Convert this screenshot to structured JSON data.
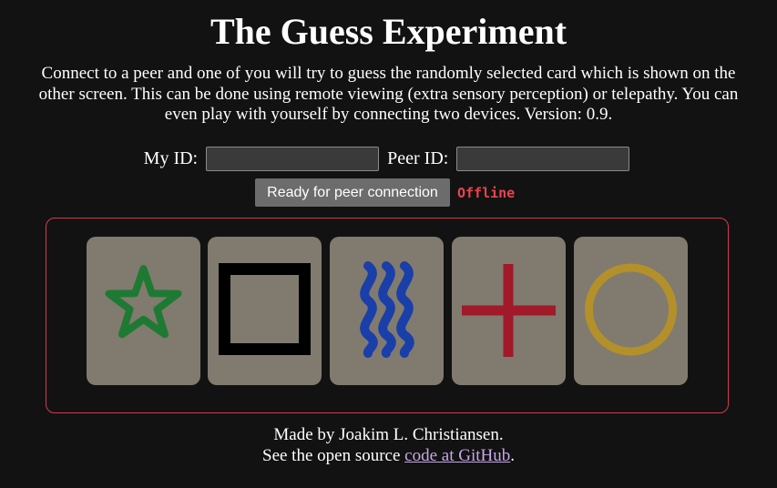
{
  "title": "The Guess Experiment",
  "intro": "Connect to a peer and one of you will try to guess the randomly selected card which is shown on the other screen. This can be done using remote viewing (extra sensory perception) or telepathy. You can even play with yourself by connecting two devices. Version: 0.9.",
  "connection": {
    "my_id_label": "My ID:",
    "my_id_value": "",
    "peer_id_label": "Peer ID:",
    "peer_id_value": "",
    "ready_button_label": "Ready for peer connection",
    "status": "Offline",
    "status_color": "#e8444f"
  },
  "cards": [
    {
      "symbol": "star-icon",
      "color": "#1e7a32"
    },
    {
      "symbol": "square-icon",
      "color": "#000000"
    },
    {
      "symbol": "waves-icon",
      "color": "#1a3fa8"
    },
    {
      "symbol": "cross-icon",
      "color": "#a01a2a"
    },
    {
      "symbol": "circle-icon",
      "color": "#b3902a"
    }
  ],
  "colors": {
    "background": "#121212",
    "card_background": "#817a6f",
    "panel_border": "#d23c50",
    "link": "#c9a7e8"
  },
  "footer": {
    "made_by": "Made by Joakim L. Christiansen.",
    "source_prefix": "See the open source ",
    "source_link": "code at GitHub",
    "source_suffix": "."
  }
}
